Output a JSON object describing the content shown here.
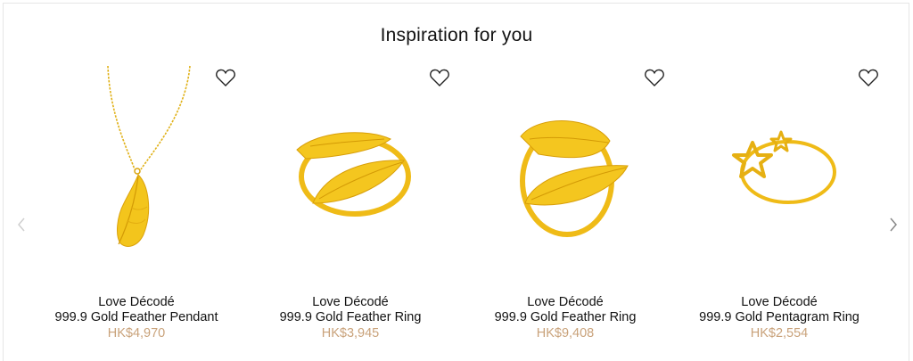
{
  "section": {
    "title": "Inspiration for you"
  },
  "colors": {
    "price": "#c9a27a",
    "gold": "#f2c01a",
    "gold_dark": "#d99a06"
  },
  "icons": {
    "wishlist": "heart-outline-icon",
    "prev": "chevron-left-icon",
    "next": "chevron-right-icon"
  },
  "products": [
    {
      "brand": "Love Décodé",
      "name": "999.9 Gold Feather Pendant",
      "price": "HK$4,970"
    },
    {
      "brand": "Love Décodé",
      "name": "999.9 Gold Feather Ring",
      "price": "HK$3,945"
    },
    {
      "brand": "Love Décodé",
      "name": "999.9 Gold Feather Ring",
      "price": "HK$9,408"
    },
    {
      "brand": "Love Décodé",
      "name": "999.9 Gold Pentagram Ring",
      "price": "HK$2,554"
    }
  ]
}
